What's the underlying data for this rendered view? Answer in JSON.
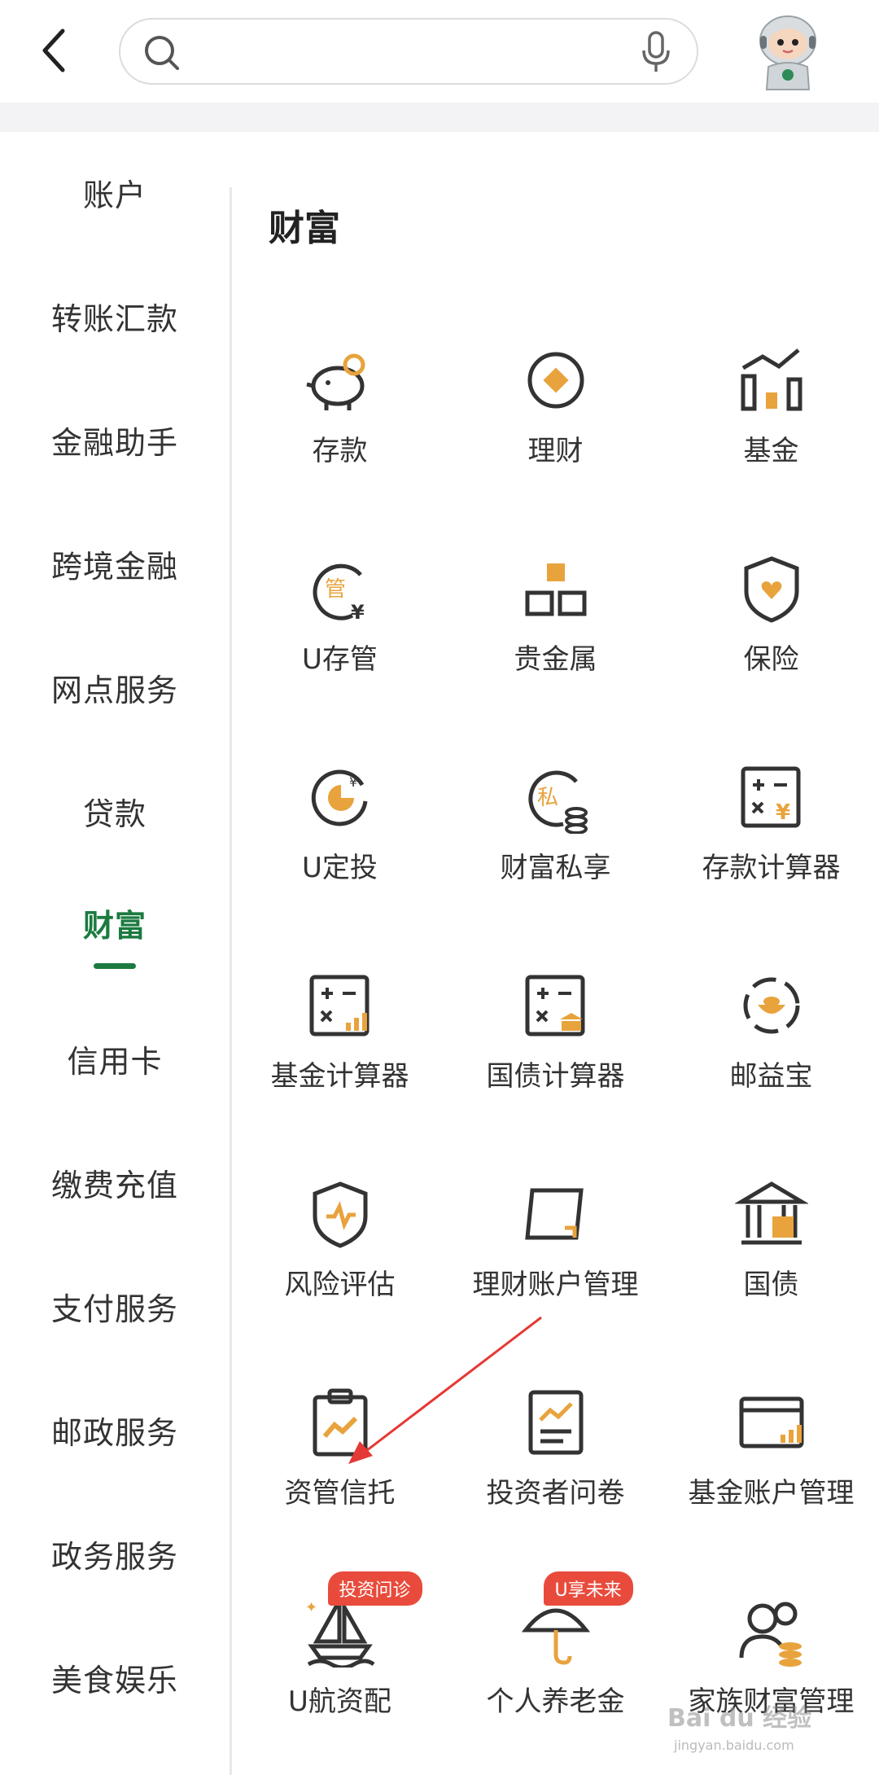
{
  "header": {
    "search_placeholder": "",
    "colors": {
      "border": "#dcdcdc",
      "band": "#f3f3f5"
    }
  },
  "sidebar": {
    "items": [
      {
        "label": "账户",
        "active": false
      },
      {
        "label": "转账汇款",
        "active": false
      },
      {
        "label": "金融助手",
        "active": false
      },
      {
        "label": "跨境金融",
        "active": false
      },
      {
        "label": "网点服务",
        "active": false
      },
      {
        "label": "贷款",
        "active": false
      },
      {
        "label": "财富",
        "active": true
      },
      {
        "label": "信用卡",
        "active": false
      },
      {
        "label": "缴费充值",
        "active": false
      },
      {
        "label": "支付服务",
        "active": false
      },
      {
        "label": "邮政服务",
        "active": false
      },
      {
        "label": "政务服务",
        "active": false
      },
      {
        "label": "美食娱乐",
        "active": false
      }
    ],
    "active_color": "#1b7a3f"
  },
  "main": {
    "section_title": "财富",
    "tiles": [
      {
        "label": "存款",
        "icon": "piggy-bank-icon"
      },
      {
        "label": "理财",
        "icon": "diamond-coin-icon"
      },
      {
        "label": "基金",
        "icon": "fund-chart-icon"
      },
      {
        "label": "U存管",
        "icon": "custody-icon"
      },
      {
        "label": "贵金属",
        "icon": "gold-bars-icon"
      },
      {
        "label": "保险",
        "icon": "shield-heart-icon"
      },
      {
        "label": "U定投",
        "icon": "fixed-invest-icon"
      },
      {
        "label": "财富私享",
        "icon": "private-wealth-icon"
      },
      {
        "label": "存款计算器",
        "icon": "deposit-calculator-icon"
      },
      {
        "label": "基金计算器",
        "icon": "fund-calculator-icon"
      },
      {
        "label": "国债计算器",
        "icon": "bond-calculator-icon"
      },
      {
        "label": "邮益宝",
        "icon": "youyibao-icon"
      },
      {
        "label": "风险评估",
        "icon": "risk-shield-icon"
      },
      {
        "label": "理财账户管理",
        "icon": "wealth-account-icon"
      },
      {
        "label": "国债",
        "icon": "bank-building-icon"
      },
      {
        "label": "资管信托",
        "icon": "clipboard-chart-icon"
      },
      {
        "label": "投资者问卷",
        "icon": "questionnaire-icon"
      },
      {
        "label": "基金账户管理",
        "icon": "fund-account-icon"
      },
      {
        "label": "U航资配",
        "icon": "sailboat-icon",
        "badge": "投资问诊"
      },
      {
        "label": "个人养老金",
        "icon": "umbrella-icon",
        "badge": "U享未来"
      },
      {
        "label": "家族财富管理",
        "icon": "family-icon"
      }
    ],
    "accent_color": "#e8a33d",
    "badge_color": "#e84b3c"
  },
  "watermark": {
    "text": "Bai du 经验",
    "sub": "jingyan.baidu.com"
  }
}
